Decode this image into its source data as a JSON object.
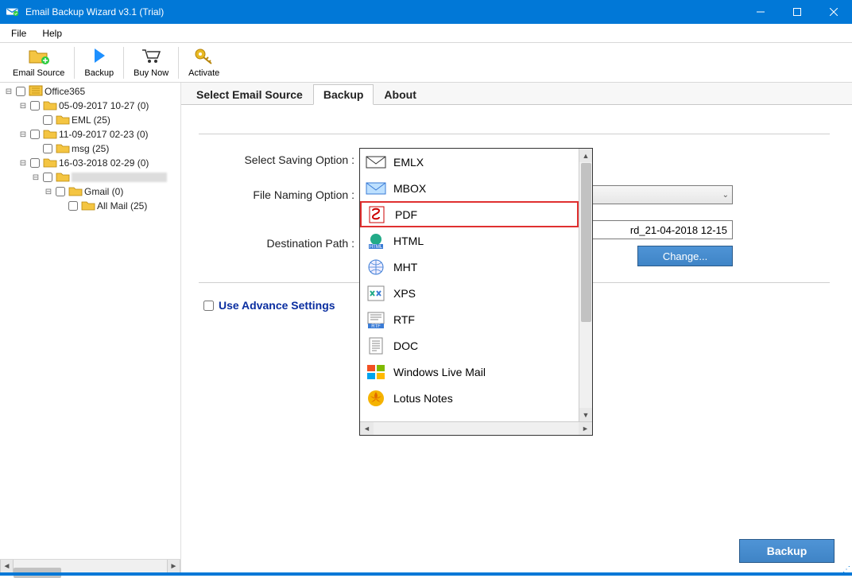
{
  "window": {
    "title": "Email Backup Wizard v3.1 (Trial)"
  },
  "menu": {
    "file": "File",
    "help": "Help"
  },
  "toolbar": {
    "email_source": "Email Source",
    "backup": "Backup",
    "buy_now": "Buy Now",
    "activate": "Activate"
  },
  "tree": {
    "root": "Office365",
    "items": [
      {
        "level": 1,
        "exp": "−",
        "label": "05-09-2017 10-27 (0)"
      },
      {
        "level": 2,
        "exp": "",
        "label": "EML (25)"
      },
      {
        "level": 1,
        "exp": "−",
        "label": "11-09-2017 02-23 (0)"
      },
      {
        "level": 2,
        "exp": "",
        "label": "msg (25)"
      },
      {
        "level": 1,
        "exp": "−",
        "label": "16-03-2018 02-29 (0)"
      },
      {
        "level": 2,
        "exp": "−",
        "label": ""
      },
      {
        "level": 3,
        "exp": "−",
        "label": "Gmail (0)"
      },
      {
        "level": 4,
        "exp": "",
        "label": "All Mail (25)"
      }
    ]
  },
  "tabs": {
    "select_source": "Select Email Source",
    "backup": "Backup",
    "about": "About"
  },
  "form": {
    "saving_label": "Select Saving Option :",
    "saving_value": "PDF",
    "naming_label": "File Naming Option :",
    "dest_label": "Destination Path :",
    "dest_value": "rd_21-04-2018 12-15",
    "change": "Change...",
    "advance": "Use Advance Settings"
  },
  "dropdown_options": [
    {
      "key": "emlx",
      "label": "EMLX"
    },
    {
      "key": "mbox",
      "label": "MBOX"
    },
    {
      "key": "pdf",
      "label": "PDF",
      "selected": true
    },
    {
      "key": "html",
      "label": "HTML"
    },
    {
      "key": "mht",
      "label": "MHT"
    },
    {
      "key": "xps",
      "label": "XPS"
    },
    {
      "key": "rtf",
      "label": "RTF"
    },
    {
      "key": "doc",
      "label": "DOC"
    },
    {
      "key": "wlm",
      "label": "Windows Live Mail"
    },
    {
      "key": "lotus",
      "label": "Lotus Notes"
    }
  ],
  "buttons": {
    "backup": "Backup"
  }
}
